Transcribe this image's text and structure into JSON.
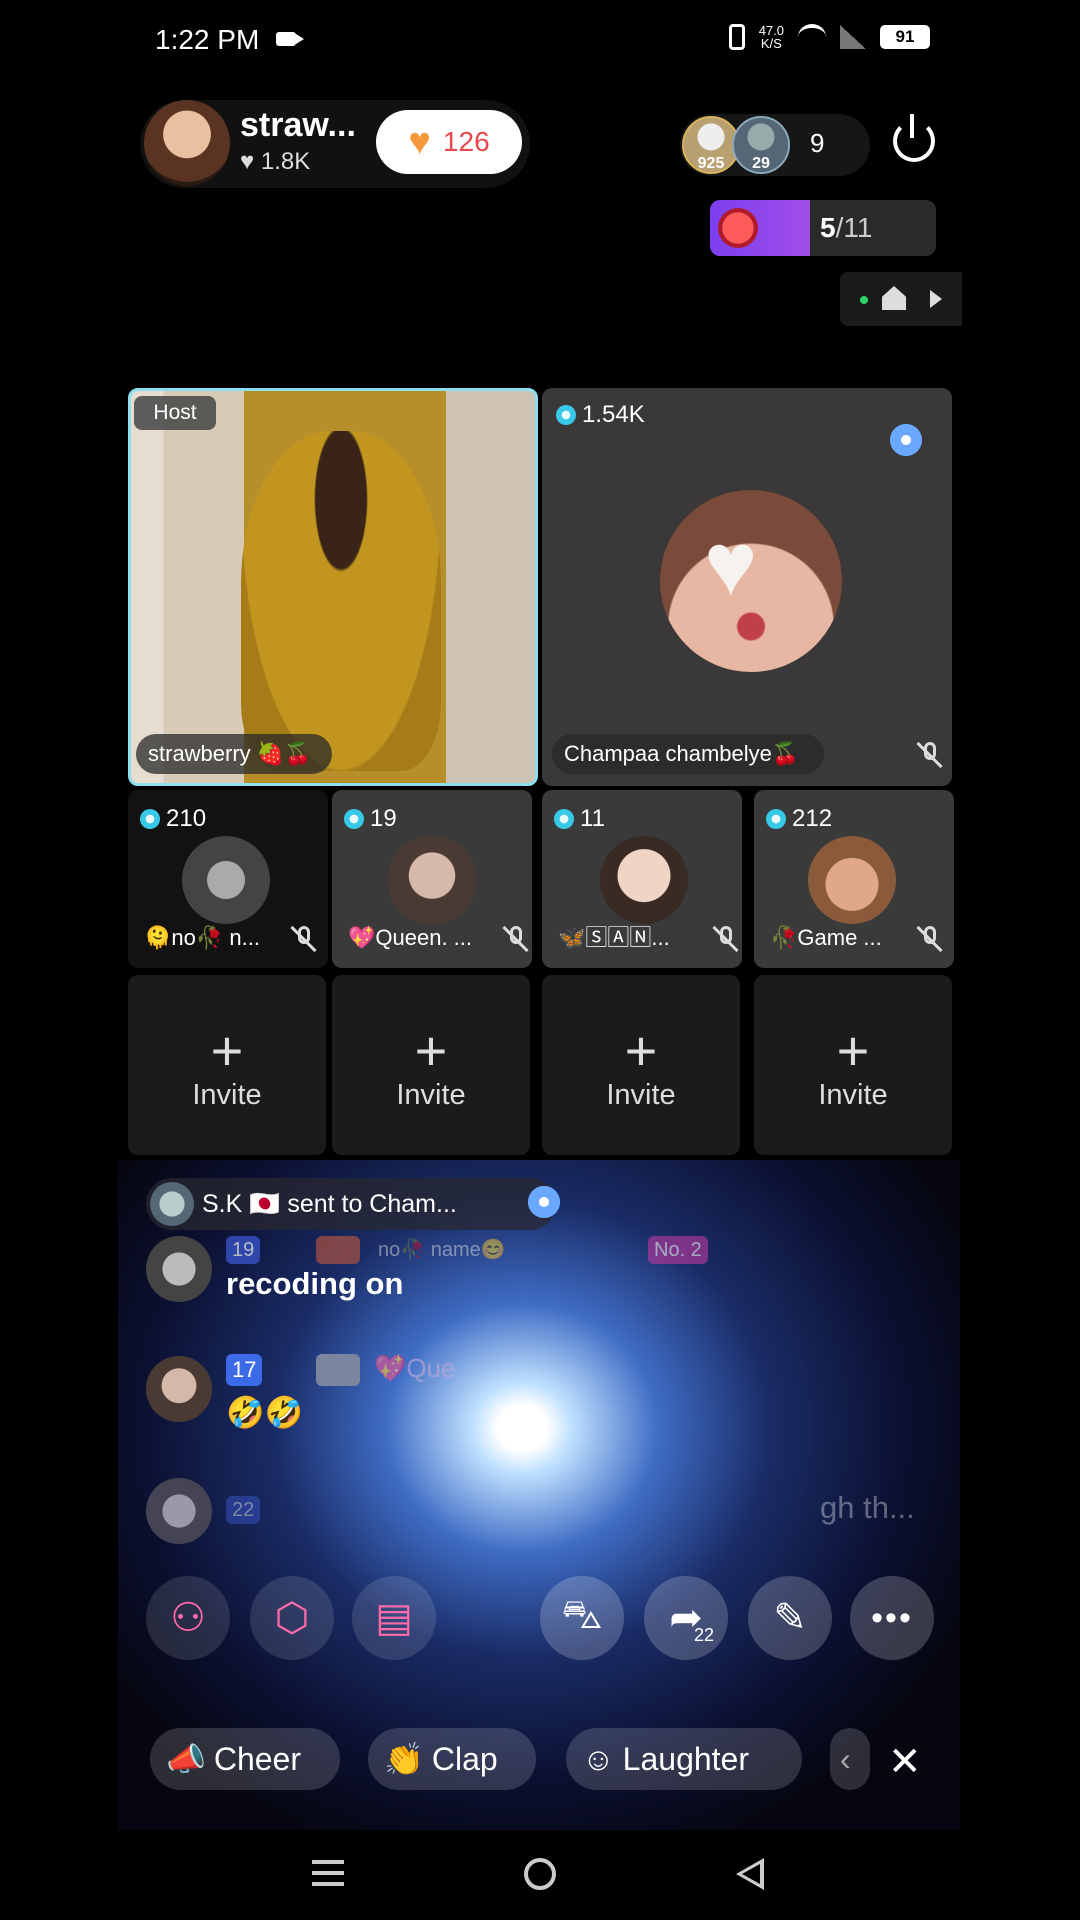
{
  "status_bar": {
    "time": "1:22 PM",
    "net_speed": "47.0",
    "net_unit": "K/S",
    "battery": "91"
  },
  "host": {
    "name": "straw...",
    "likes": "♥ 1.8K",
    "follow_count": "126"
  },
  "viewers": {
    "badge1": "925",
    "badge2": "29",
    "count": "9"
  },
  "goal": {
    "current": "5",
    "total": "/11"
  },
  "seats": {
    "host": {
      "tag": "Host",
      "name": "strawberry 🍓🍒"
    },
    "guest": {
      "gems": "1.54K",
      "name": "Champaa chambelye🍒"
    },
    "small": [
      {
        "gems": "210",
        "name": "🫠no🥀 n..."
      },
      {
        "gems": "19",
        "name": "💖Queen. ..."
      },
      {
        "gems": "11",
        "name": "🦋🅂🄰🄽..."
      },
      {
        "gems": "212",
        "name": "🥀Game ..."
      }
    ],
    "invite_label": "Invite",
    "invite_plus": "+"
  },
  "gift_banner": {
    "text": "S.K 🇯🇵 sent to Cham..."
  },
  "chat": [
    {
      "badges": [
        "19",
        "no🥀 name😊",
        "No. 2"
      ],
      "message": "recoding on"
    },
    {
      "badges": [
        "17",
        "💖Que"
      ],
      "message": "🤣🤣"
    },
    {
      "badges": [
        "22"
      ],
      "message": "gh th..."
    }
  ],
  "actions": {
    "share_count": "22"
  },
  "reactions": [
    {
      "icon": "cheer-icon",
      "label": "Cheer"
    },
    {
      "icon": "clap-icon",
      "label": "Clap"
    },
    {
      "icon": "laughter-icon",
      "label": "Laughter"
    }
  ]
}
